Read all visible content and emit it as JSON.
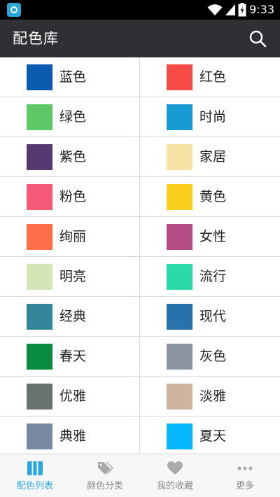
{
  "status_bar": {
    "time": "9:33",
    "icons": [
      "app-notification-icon",
      "wifi-icon",
      "signal-icon",
      "battery-icon"
    ]
  },
  "app_bar": {
    "title": "配色库",
    "search_icon": "search-icon"
  },
  "colors": {
    "accent": "#29a8e0",
    "app_bar_bg": "#2f3033",
    "nav_inactive": "#aaaaaa"
  },
  "color_categories": [
    {
      "label": "蓝色",
      "color": "#0a5baf"
    },
    {
      "label": "红色",
      "color": "#f64a47"
    },
    {
      "label": "绿色",
      "color": "#5ec766"
    },
    {
      "label": "时尚",
      "color": "#189bd2"
    },
    {
      "label": "紫色",
      "color": "#563970"
    },
    {
      "label": "家居",
      "color": "#f7e2a6"
    },
    {
      "label": "粉色",
      "color": "#f55a79"
    },
    {
      "label": "黄色",
      "color": "#f8cd1c"
    },
    {
      "label": "绚丽",
      "color": "#fd6e49"
    },
    {
      "label": "女性",
      "color": "#b64c86"
    },
    {
      "label": "明亮",
      "color": "#d2e6b6"
    },
    {
      "label": "流行",
      "color": "#2bd8a7"
    },
    {
      "label": "经典",
      "color": "#33869a"
    },
    {
      "label": "现代",
      "color": "#2771ad"
    },
    {
      "label": "春天",
      "color": "#0a8b41"
    },
    {
      "label": "灰色",
      "color": "#8c95a2"
    },
    {
      "label": "优雅",
      "color": "#6a7171"
    },
    {
      "label": "淡雅",
      "color": "#cfb59f"
    },
    {
      "label": "典雅",
      "color": "#7889a3"
    },
    {
      "label": "夏天",
      "color": "#06b7fb"
    }
  ],
  "bottom_nav": [
    {
      "label": "配色列表",
      "icon": "list-columns-icon",
      "active": true
    },
    {
      "label": "颜色分类",
      "icon": "tags-icon",
      "active": false
    },
    {
      "label": "我的收藏",
      "icon": "heart-icon",
      "active": false
    },
    {
      "label": "更多",
      "icon": "more-dots-icon",
      "active": false
    }
  ]
}
